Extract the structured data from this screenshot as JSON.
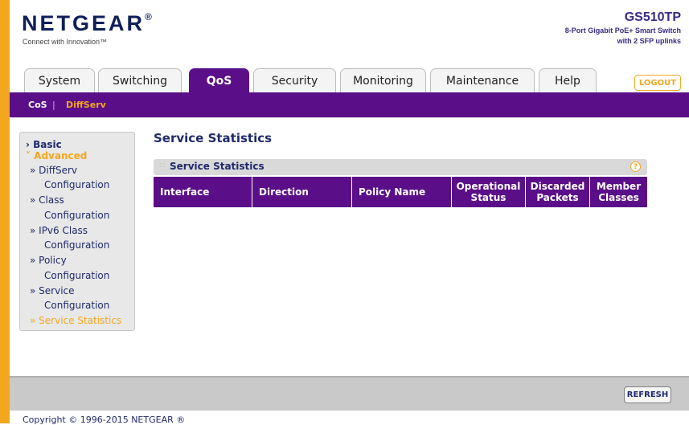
{
  "header": {
    "logo": "NETGEAR",
    "logo_mark": "®",
    "tagline": "Connect with Innovation™",
    "model_name": "GS510TP",
    "model_desc_line1": "8-Port Gigabit PoE+ Smart Switch",
    "model_desc_line2": "with 2 SFP uplinks"
  },
  "tabs": [
    {
      "label": "System"
    },
    {
      "label": "Switching"
    },
    {
      "label": "QoS"
    },
    {
      "label": "Security"
    },
    {
      "label": "Monitoring"
    },
    {
      "label": "Maintenance"
    },
    {
      "label": "Help"
    }
  ],
  "active_tab": "QoS",
  "logout_label": "LOGOUT",
  "subnav": {
    "cos": "CoS",
    "separator": "|",
    "diffserv": "DiffServ"
  },
  "left_nav": {
    "basic": "› Basic",
    "advanced": "˅ Advanced",
    "items": [
      {
        "line1": "» DiffServ",
        "line2": "Configuration"
      },
      {
        "line1": "» Class",
        "line2": "Configuration"
      },
      {
        "line1": "» IPv6 Class",
        "line2": "Configuration"
      },
      {
        "line1": "» Policy",
        "line2": "Configuration"
      },
      {
        "line1": "» Service",
        "line2": "Configuration"
      }
    ],
    "current": "» Service Statistics"
  },
  "page_title": "Service Statistics",
  "section": {
    "title": "Service Statistics",
    "help": "?"
  },
  "table": {
    "headers": [
      {
        "line1": "Interface",
        "line2": ""
      },
      {
        "line1": "Direction",
        "line2": ""
      },
      {
        "line1": "Policy Name",
        "line2": ""
      },
      {
        "line1": "Operational",
        "line2": "Status"
      },
      {
        "line1": "Discarded",
        "line2": "Packets"
      },
      {
        "line1": "Member",
        "line2": "Classes"
      }
    ],
    "rows": []
  },
  "refresh_label": "REFRESH",
  "copyright": "Copyright © 1996-2015 NETGEAR ®",
  "colors": {
    "brand_purple": "#5a0f88",
    "accent_orange": "#f3a71f",
    "navy_text": "#1f2a6b"
  }
}
